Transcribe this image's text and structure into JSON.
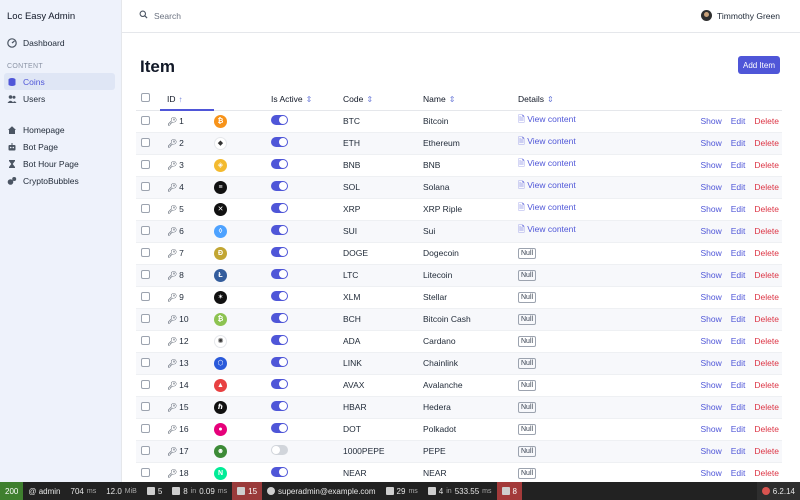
{
  "app": {
    "title": "Loc Easy Admin"
  },
  "sidebar": {
    "dashboard": "Dashboard",
    "section_label": "CONTENT",
    "content_items": [
      {
        "label": "Coins",
        "icon": "database-icon",
        "active": true
      },
      {
        "label": "Users",
        "icon": "users-icon",
        "active": false
      }
    ],
    "links": [
      {
        "label": "Homepage",
        "icon": "home-icon"
      },
      {
        "label": "Bot Page",
        "icon": "robot-icon"
      },
      {
        "label": "Bot Hour Page",
        "icon": "hourglass-icon"
      },
      {
        "label": "CryptoBubbles",
        "icon": "bubbles-icon"
      }
    ]
  },
  "topbar": {
    "search_placeholder": "Search",
    "user_name": "Timmothy Green"
  },
  "page": {
    "title": "Item",
    "add_button": "Add Item"
  },
  "table": {
    "columns": {
      "id": "ID",
      "is_active": "Is Active",
      "code": "Code",
      "name": "Name",
      "details": "Details"
    },
    "actions": {
      "show": "Show",
      "edit": "Edit",
      "delete": "Delete"
    },
    "view_label": "View content",
    "null_label": "Null",
    "rows": [
      {
        "id": "1",
        "code": "BTC",
        "name": "Bitcoin",
        "active": true,
        "details": "view",
        "color": "#f7931a",
        "glyph": "₿"
      },
      {
        "id": "2",
        "code": "ETH",
        "name": "Ethereum",
        "active": true,
        "details": "view",
        "color": "#ffffff",
        "glyph": "◆"
      },
      {
        "id": "3",
        "code": "BNB",
        "name": "BNB",
        "active": true,
        "details": "view",
        "color": "#f3ba2f",
        "glyph": "◈"
      },
      {
        "id": "4",
        "code": "SOL",
        "name": "Solana",
        "active": true,
        "details": "view",
        "color": "#111111",
        "glyph": "≡"
      },
      {
        "id": "5",
        "code": "XRP",
        "name": "XRP Riple",
        "active": true,
        "details": "view",
        "color": "#111111",
        "glyph": "✕"
      },
      {
        "id": "6",
        "code": "SUI",
        "name": "Sui",
        "active": true,
        "details": "view",
        "color": "#4da2ff",
        "glyph": "◊"
      },
      {
        "id": "7",
        "code": "DOGE",
        "name": "Dogecoin",
        "active": true,
        "details": "null",
        "color": "#c2a633",
        "glyph": "Ð"
      },
      {
        "id": "8",
        "code": "LTC",
        "name": "Litecoin",
        "active": true,
        "details": "null",
        "color": "#345d9d",
        "glyph": "Ł"
      },
      {
        "id": "9",
        "code": "XLM",
        "name": "Stellar",
        "active": true,
        "details": "null",
        "color": "#111111",
        "glyph": "✶"
      },
      {
        "id": "10",
        "code": "BCH",
        "name": "Bitcoin Cash",
        "active": true,
        "details": "null",
        "color": "#8dc351",
        "glyph": "₿"
      },
      {
        "id": "12",
        "code": "ADA",
        "name": "Cardano",
        "active": true,
        "details": "null",
        "color": "#ffffff",
        "glyph": "✺"
      },
      {
        "id": "13",
        "code": "LINK",
        "name": "Chainlink",
        "active": true,
        "details": "null",
        "color": "#2a5ada",
        "glyph": "⬡"
      },
      {
        "id": "14",
        "code": "AVAX",
        "name": "Avalanche",
        "active": true,
        "details": "null",
        "color": "#e84142",
        "glyph": "▲"
      },
      {
        "id": "15",
        "code": "HBAR",
        "name": "Hedera",
        "active": true,
        "details": "null",
        "color": "#111111",
        "glyph": "ℏ"
      },
      {
        "id": "16",
        "code": "DOT",
        "name": "Polkadot",
        "active": true,
        "details": "null",
        "color": "#e6007a",
        "glyph": "●"
      },
      {
        "id": "17",
        "code": "1000PEPE",
        "name": "PEPE",
        "active": false,
        "details": "null",
        "color": "#3d8b37",
        "glyph": "☻"
      },
      {
        "id": "18",
        "code": "NEAR",
        "name": "NEAR",
        "active": true,
        "details": "null",
        "color": "#00ec97",
        "glyph": "N"
      }
    ]
  },
  "debugbar": {
    "status": "200",
    "user": "@ admin",
    "time": "704",
    "time_unit": "ms",
    "memory": "12.0",
    "memory_unit": "MiB",
    "forms": "5",
    "cache": "8",
    "cache_sub": "in",
    "cache_time": "0.09",
    "cache_unit": "ms",
    "logs": "15",
    "email": "superadmin@example.com",
    "twig": "29",
    "twig_unit": "ms",
    "db": "4",
    "db_sub": "in",
    "db_time": "533.55",
    "db_unit": "ms",
    "errors": "8",
    "version": "6.2.14"
  }
}
